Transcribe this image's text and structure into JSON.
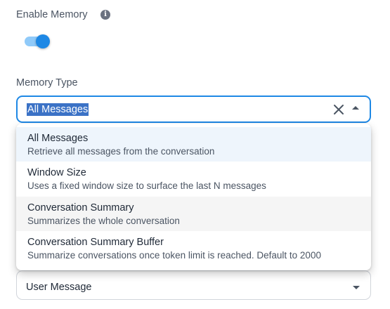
{
  "memory": {
    "label": "Enable Memory",
    "info_icon": "info-icon",
    "enabled": true,
    "toggle_color": "#1e88e5"
  },
  "memory_type": {
    "label": "Memory Type",
    "selected": "All Messages",
    "clear_icon": "close-icon",
    "arrow_icon": "chevron-up-icon",
    "accent_color": "#1e88e5",
    "options": [
      {
        "title": "All Messages",
        "description": "Retrieve all messages from the conversation"
      },
      {
        "title": "Window Size",
        "description": "Uses a fixed window size to surface the last N messages"
      },
      {
        "title": "Conversation Summary",
        "description": "Summarizes the whole conversation"
      },
      {
        "title": "Conversation Summary Buffer",
        "description": "Summarize conversations once token limit is reached. Default to 2000"
      }
    ]
  },
  "message_select": {
    "selected": "User Message",
    "arrow_icon": "chevron-down-icon"
  }
}
